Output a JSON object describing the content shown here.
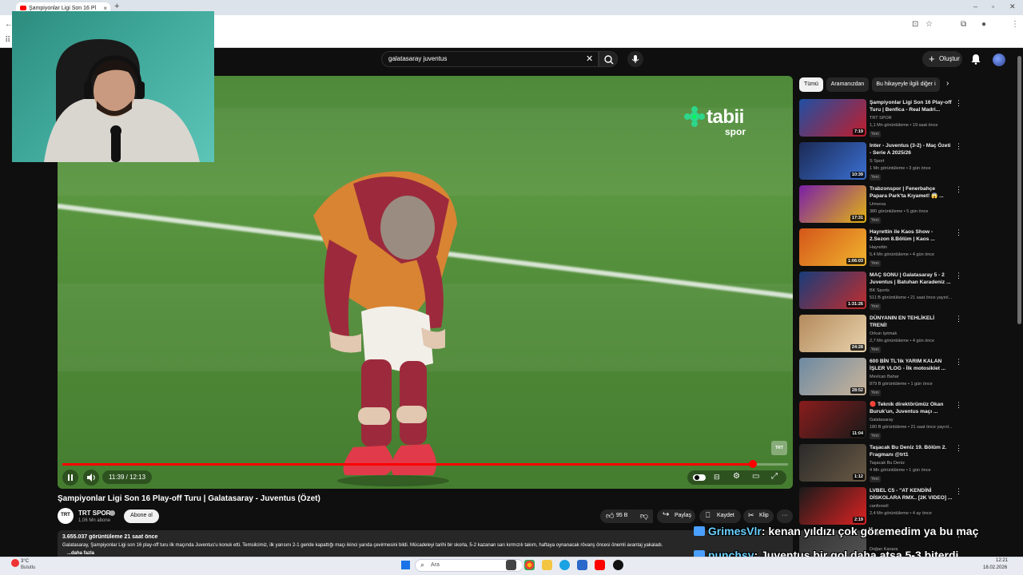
{
  "browser": {
    "tab_title": "Şampiyonlar Ligi Son 16 Pl",
    "tab_close": "×",
    "new_tab": "+"
  },
  "header": {
    "search_value": "galatasaray juventus",
    "create_label": "Oluştur"
  },
  "player": {
    "watermark_brand": "tabii",
    "watermark_sub": "spor",
    "channel_bug": "TRT",
    "time": "11:39 / 12:13",
    "progress": 0.952
  },
  "video": {
    "title": "Şampiyonlar Ligi Son 16 Play-off Turu | Galatasaray - Juventus (Özet)",
    "channel": "TRT SPOR",
    "channel_avatar": "TRT",
    "subscribers": "1,06 Mn abone",
    "subscribe_label": "Abone ol",
    "likes": "95 B",
    "share_label": "Paylaş",
    "save_label": "Kaydet",
    "clip_label": "Klip",
    "more_label": "···",
    "views_time": "3.655.037 görüntüleme  21 saat önce",
    "description": "Galatasaray, Şampiyonlar Ligi son 16 play-off turu ilk maçında Juventus'u konuk etti.   Temsilcimiz, ilk yarısını 2-1 geride kapattığı maçı ikinci yarıda çevirmesini bildi. Mücadeleyi tarihi bir skorla, 5-2 kazanan sarı kırmızılı takım, haftaya oynanacak rövanş öncesi önemli avantaj yakaladı.",
    "more_text": "...daha fazla"
  },
  "sidebar": {
    "chips": [
      "Tümü",
      "Aramanızdan",
      "Bu hikayeyle ilgili diğer i"
    ],
    "items": [
      {
        "title": "Şampiyonlar Ligi Son 16 Play-off Turu | Benfica - Real Madri...",
        "channel": "TRT SPOR",
        "meta": "1,1 Mn görüntüleme • 19 saat önce",
        "badge": "Yeni",
        "duration": "7:19"
      },
      {
        "title": "Inter - Juventus (3-2) - Maç Özeti - Serie A 2025/26",
        "channel": "S Sport",
        "meta": "1 Mn görüntüleme • 3 gün önce",
        "badge": "Yeni",
        "duration": "10:39"
      },
      {
        "title": "Trabzonspor | Fenerbahçe Papara Park'ta Kıyamet! 😱 ...",
        "channel": "Umvexa",
        "meta": "380 görüntüleme • 5 gün önce",
        "badge": "Yeni",
        "duration": "17:31"
      },
      {
        "title": "Hayrettin ile Kaos Show - 2.Sezon 8.Bölüm | Kaos ...",
        "channel": "Hayrettin",
        "meta": "5,4 Mn görüntüleme • 4 gün önce",
        "badge": "Yeni",
        "duration": "1:06:03"
      },
      {
        "title": "MAÇ SONU | Galatasaray 5 - 2 Juventus | Batuhan Karadeniz ...",
        "channel": "BK Sports",
        "meta": "511 B görüntüleme • 21 saat önce yayınl...",
        "badge": "Yeni",
        "duration": "1:31:26"
      },
      {
        "title": "DÜNYANIN EN TEHLİKELİ TRENİ!",
        "channel": "Orkun Işıtmak",
        "meta": "2,7 Mn görüntüleme • 4 gün önce",
        "badge": "Yeni",
        "duration": "24:28"
      },
      {
        "title": "600 BİN TL'lik YARIM KALAN İŞLER VLOG - İlk motosiklet ...",
        "channel": "Mevlcan Bahar",
        "meta": "879 B görüntüleme • 1 gün önce",
        "badge": "Yeni",
        "duration": "28:52"
      },
      {
        "title": "🔴 Teknik direktörümüz Okan Buruk'un, Juventus maçı ...",
        "channel": "Galatasaray",
        "meta": "180 B görüntüleme • 21 saat önce yayınl...",
        "badge": "Yeni",
        "duration": "11:04"
      },
      {
        "title": "Taşacak Bu Deniz 19. Bölüm 2. Fragmanı @trt1",
        "channel": "Taşacak Bu Deniz",
        "meta": "4 Mn görüntüleme • 1 gün önce",
        "badge": "Yeni",
        "duration": "1:12"
      },
      {
        "title": "LVBEL C5 - \"AT KENDİNİ DİSKOLARA RMX.. [2K VIDEO] ...",
        "channel": "canforsell",
        "meta": "2,4 Mn görüntüleme • 4 ay önce",
        "badge": "",
        "duration": "2:19"
      },
      {
        "title": "Önü Atmosferi",
        "channel": "Doğan Kanara",
        "meta": "",
        "badge": "",
        "duration": ""
      }
    ]
  },
  "chat": [
    {
      "user": "GrimesVlr",
      "message": ": kenan yıldızı çok göremedim ya bu maç"
    },
    {
      "user": "punchsy",
      "message": ": Juventus bir gol daha atsa 5-3 biterdi"
    }
  ],
  "taskbar": {
    "weather_temp": "3°C",
    "weather_desc": "Bulutlu",
    "search_placeholder": "Ara",
    "clock_time": "12:21",
    "clock_date": "18.02.2026"
  },
  "colors": {
    "accent": "#ff0000",
    "chat_user1": "#6ad1ff",
    "chat_user2": "#6ad1ff"
  }
}
